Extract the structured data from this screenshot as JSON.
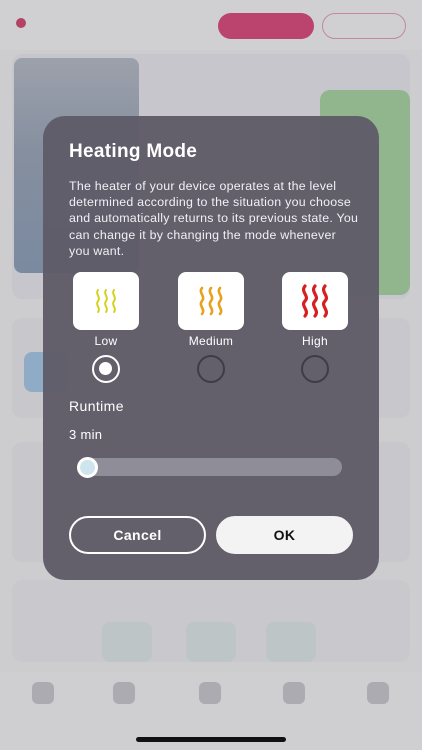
{
  "modal": {
    "title": "Heating Mode",
    "description": "The heater of your device operates at the level determined according to the situation you choose and automatically returns to its previous state. You can change it by changing the mode whenever you want.",
    "modes": [
      {
        "label": "Low",
        "icon": "heat-waves-low-icon",
        "color": "#d3d21f",
        "selected": true
      },
      {
        "label": "Medium",
        "icon": "heat-waves-medium-icon",
        "color": "#e6a21e",
        "selected": false
      },
      {
        "label": "High",
        "icon": "heat-waves-high-icon",
        "color": "#d62020",
        "selected": false
      }
    ],
    "runtime": {
      "label": "Runtime",
      "value": "3 min",
      "slider_fraction": 0.0
    },
    "cancel_label": "Cancel",
    "ok_label": "OK"
  },
  "colors": {
    "modal_bg": "#5f5c68",
    "accent_pink": "#db4b7a"
  }
}
